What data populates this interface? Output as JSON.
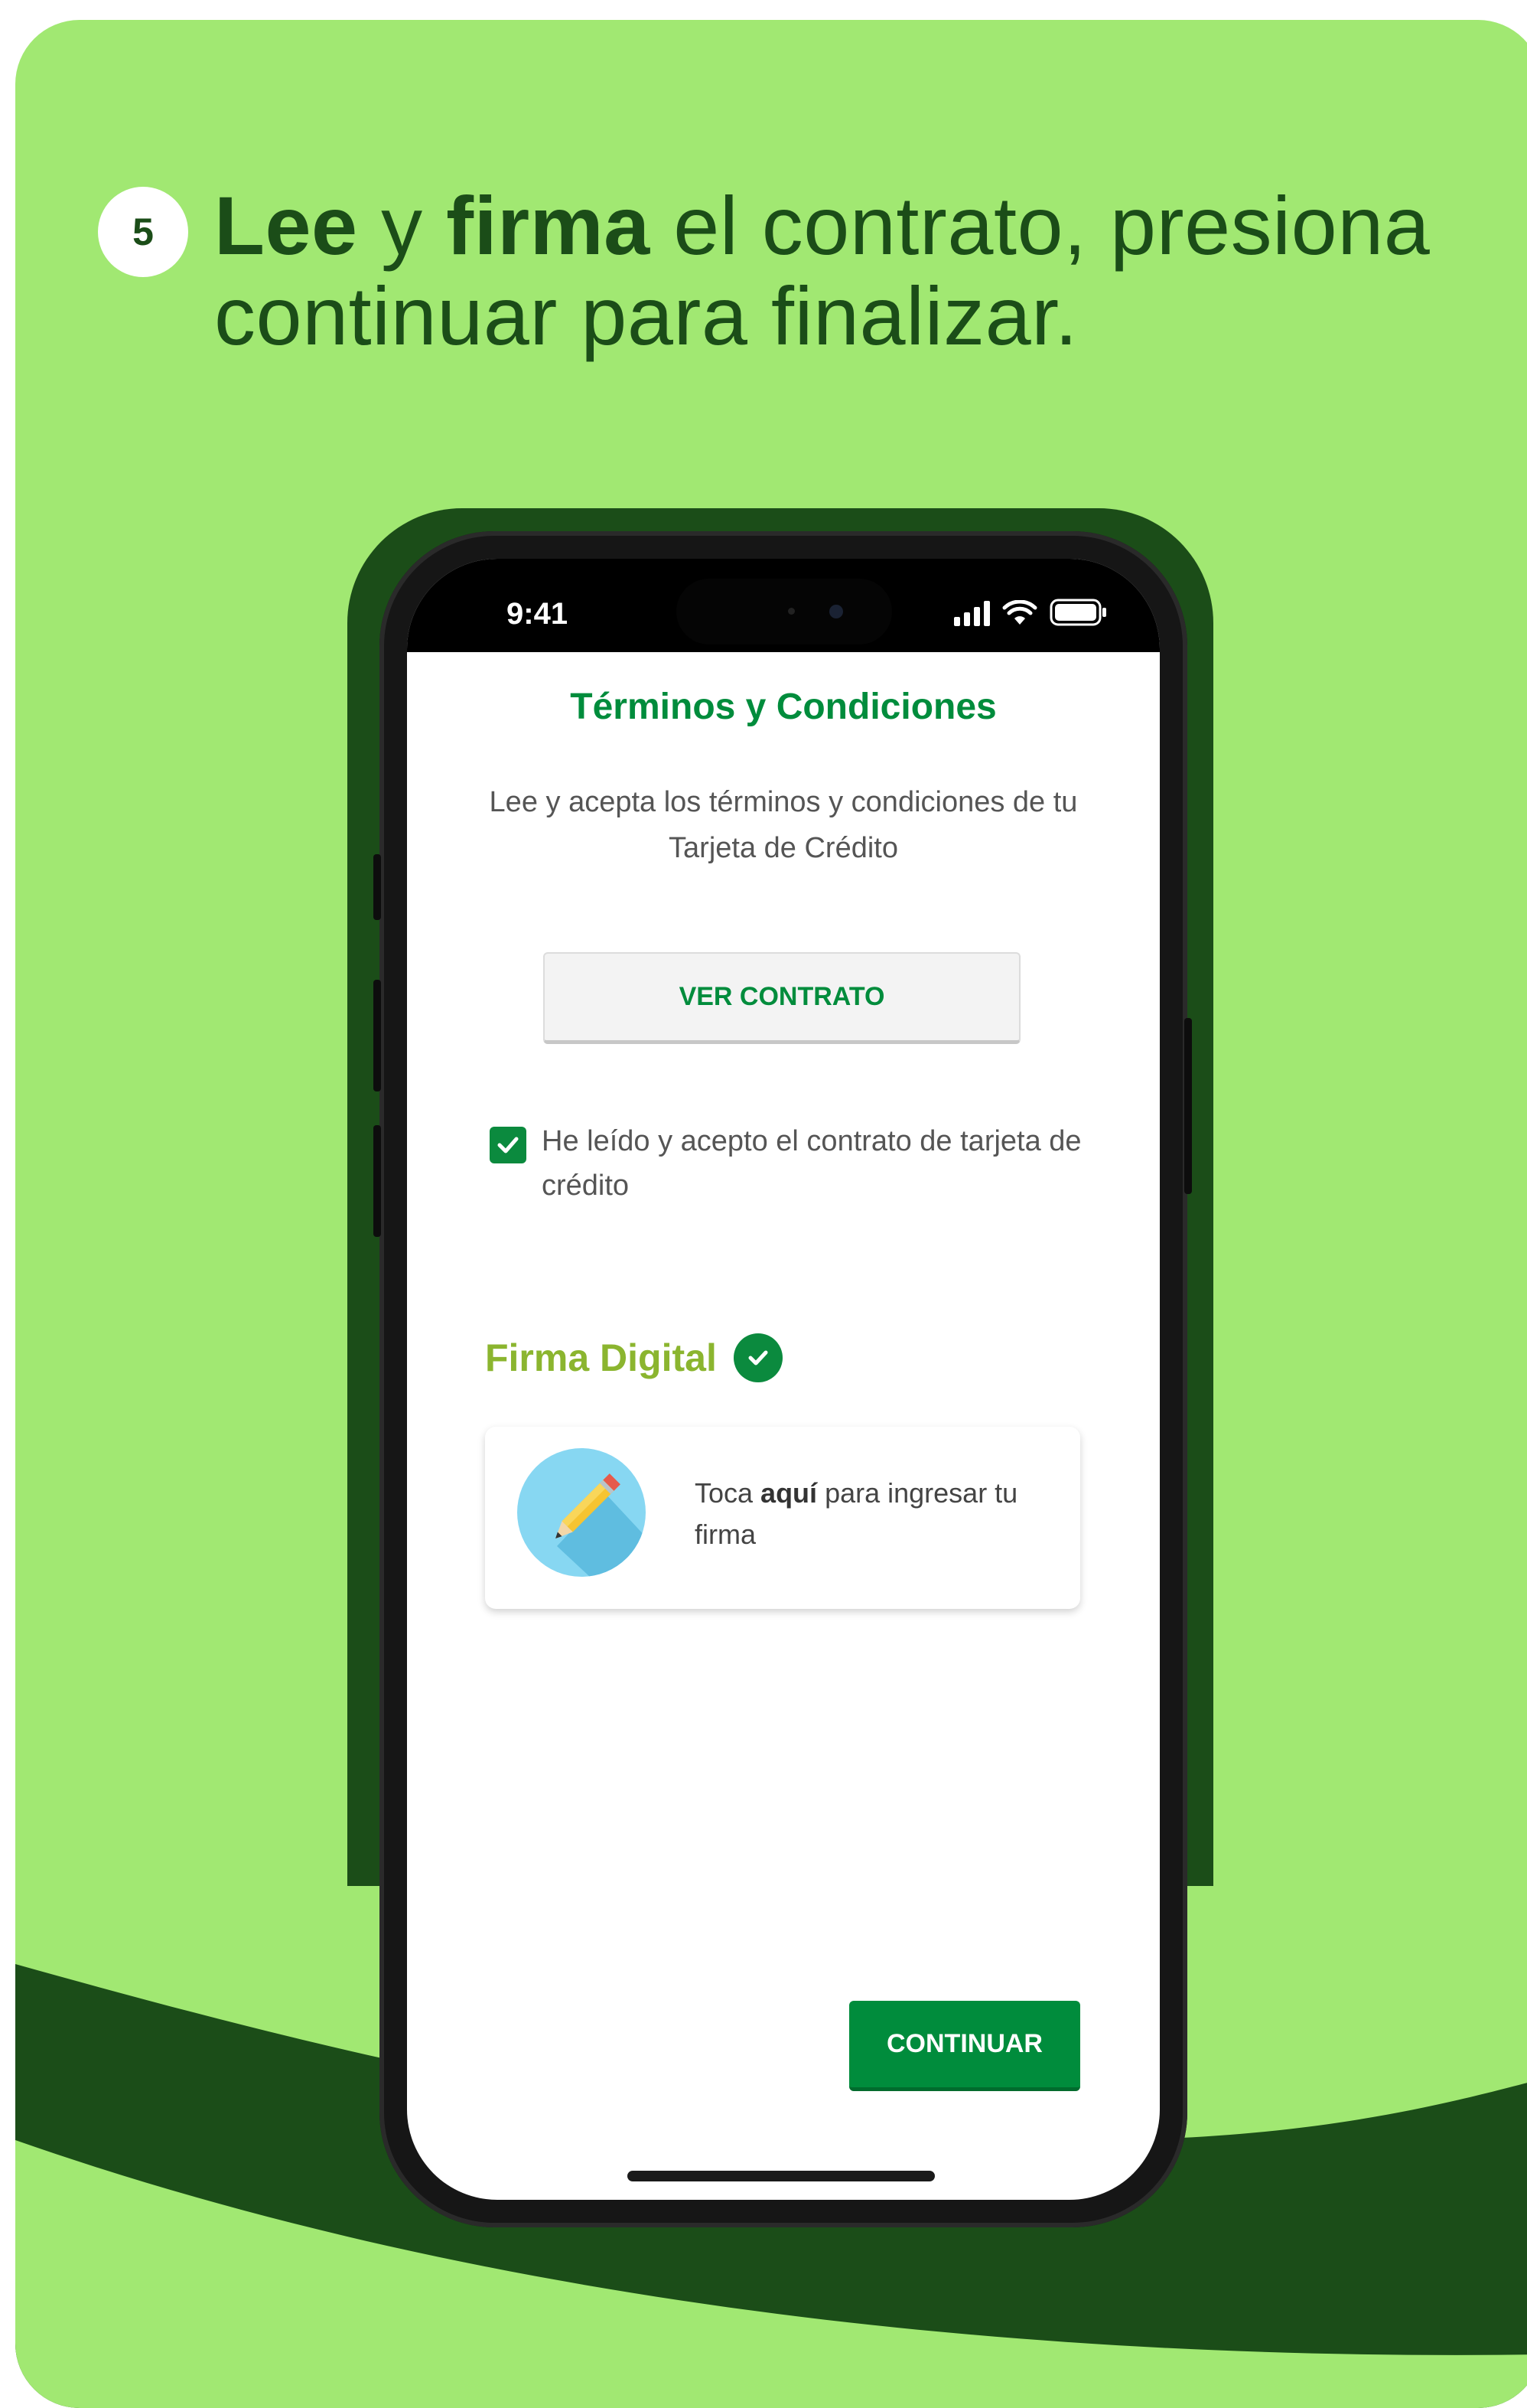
{
  "headline": {
    "step_number": "5",
    "bold_1": "Lee",
    "text_1": " y ",
    "bold_2": "firma",
    "text_2": " el contrato, presiona",
    "line_2": "continuar para finalizar."
  },
  "phone": {
    "status_time": "9:41",
    "screen": {
      "title": "Términos y Condiciones",
      "subtitle": "Lee y acepta los términos y condiciones de tu Tarjeta de Crédito",
      "view_contract_label": "VER CONTRATO",
      "accept_checkbox": {
        "checked": true,
        "label": "He leído y acepto el contrato de tarjeta de crédito"
      },
      "signature_section": {
        "title": "Firma Digital",
        "completed": true,
        "card_text_before": "Toca ",
        "card_text_bold": "aquí",
        "card_text_after": " para ingresar tu firma"
      },
      "continue_label": "CONTINUAR"
    }
  },
  "colors": {
    "card_background": "#a1e872",
    "dark_green": "#1b4d18",
    "brand_green": "#008c3c",
    "accent_olive": "#8bb52f",
    "pencil_circle": "#87d7f2"
  },
  "icons": [
    "checkbox-checked-icon",
    "check-circle-icon",
    "pencil-icon",
    "signal-icon",
    "wifi-icon",
    "battery-icon"
  ]
}
